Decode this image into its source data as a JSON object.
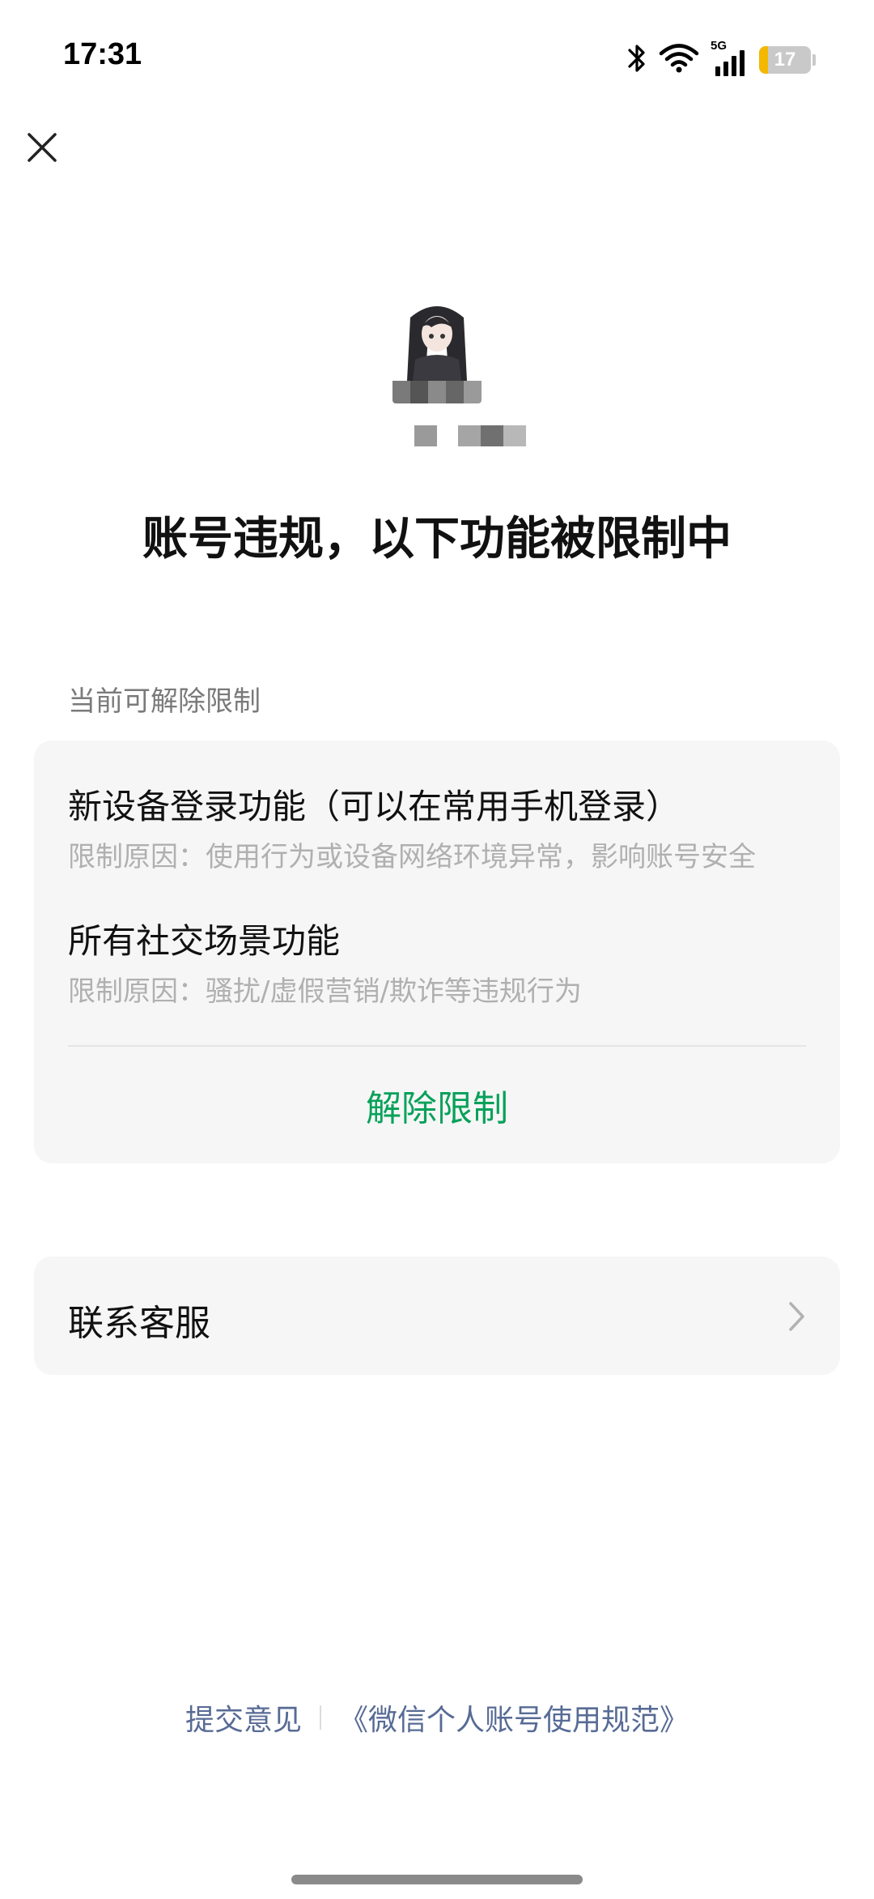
{
  "status_bar": {
    "time": "17:31",
    "network": "5G",
    "battery": "17",
    "battery_level_percent": 17,
    "icons": [
      "bluetooth-icon",
      "wifi-icon",
      "cellular-signal-icon",
      "battery-icon"
    ]
  },
  "header": {
    "close_icon": "close-icon"
  },
  "profile": {
    "headline": "账号违规，以下功能被限制中"
  },
  "restrictions": {
    "section_label": "当前可解除限制",
    "items": [
      {
        "title": "新设备登录功能（可以在常用手机登录）",
        "reason": "限制原因：使用行为或设备网络环境异常，影响账号安全"
      },
      {
        "title": "所有社交场景功能",
        "reason": "限制原因：骚扰/虚假营销/欺诈等违规行为"
      }
    ],
    "unlock_button": "解除限制"
  },
  "service": {
    "label": "联系客服",
    "chevron_icon": "chevron-right-icon"
  },
  "footer": {
    "feedback_link": "提交意见",
    "policy_link": "《微信个人账号使用规范》"
  },
  "colors": {
    "accent_green": "#07a15a",
    "link_blue": "#576b95",
    "card_bg": "#f6f6f6",
    "battery_yellow": "#f5b800"
  }
}
